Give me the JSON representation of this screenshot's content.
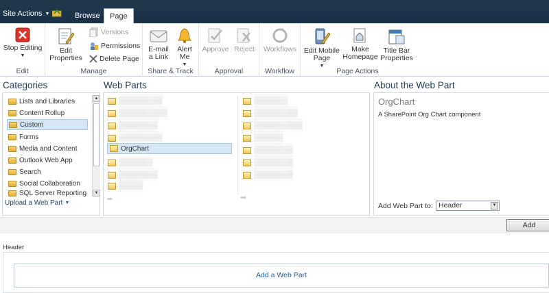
{
  "header": {
    "site_actions": "Site Actions",
    "tabs": {
      "browse": "Browse",
      "page": "Page"
    }
  },
  "ribbon": {
    "groups": {
      "edit": "Edit",
      "manage": "Manage",
      "share_track": "Share & Track",
      "approval": "Approval",
      "workflow": "Workflow",
      "page_actions": "Page Actions"
    },
    "stop_editing": "Stop Editing",
    "edit_properties": "Edit Properties",
    "versions": "Versions",
    "permissions": "Permissions",
    "delete_page": "Delete Page",
    "email_link": "E-mail a Link",
    "alert_me": "Alert Me",
    "approve": "Approve",
    "reject": "Reject",
    "workflows": "Workflows",
    "edit_mobile_page": "Edit Mobile Page",
    "make_homepage": "Make Homepage",
    "title_bar_properties": "Title Bar Properties"
  },
  "categories": {
    "title": "Categories",
    "items": [
      "Lists and Libraries",
      "Content Rollup",
      "Custom",
      "Forms",
      "Media and Content",
      "Outlook Web App",
      "Search",
      "Social Collaboration",
      "SQL Server Reporting"
    ],
    "selected": "Custom",
    "upload_link": "Upload a Web Part"
  },
  "web_parts": {
    "title": "Web Parts",
    "selected": "OrgChart"
  },
  "about": {
    "title": "About the Web Part",
    "part_name": "OrgChart",
    "description": "A SharePoint Org Chart component",
    "add_to_label": "Add Web Part to:",
    "zone_value": "Header",
    "add_button": "Add"
  },
  "zone": {
    "label": "Header",
    "add_link": "Add a Web Part"
  },
  "colors": {
    "topbar": "#21374c",
    "accent": "#1f3d5c",
    "selection": "#d6e8f8"
  }
}
